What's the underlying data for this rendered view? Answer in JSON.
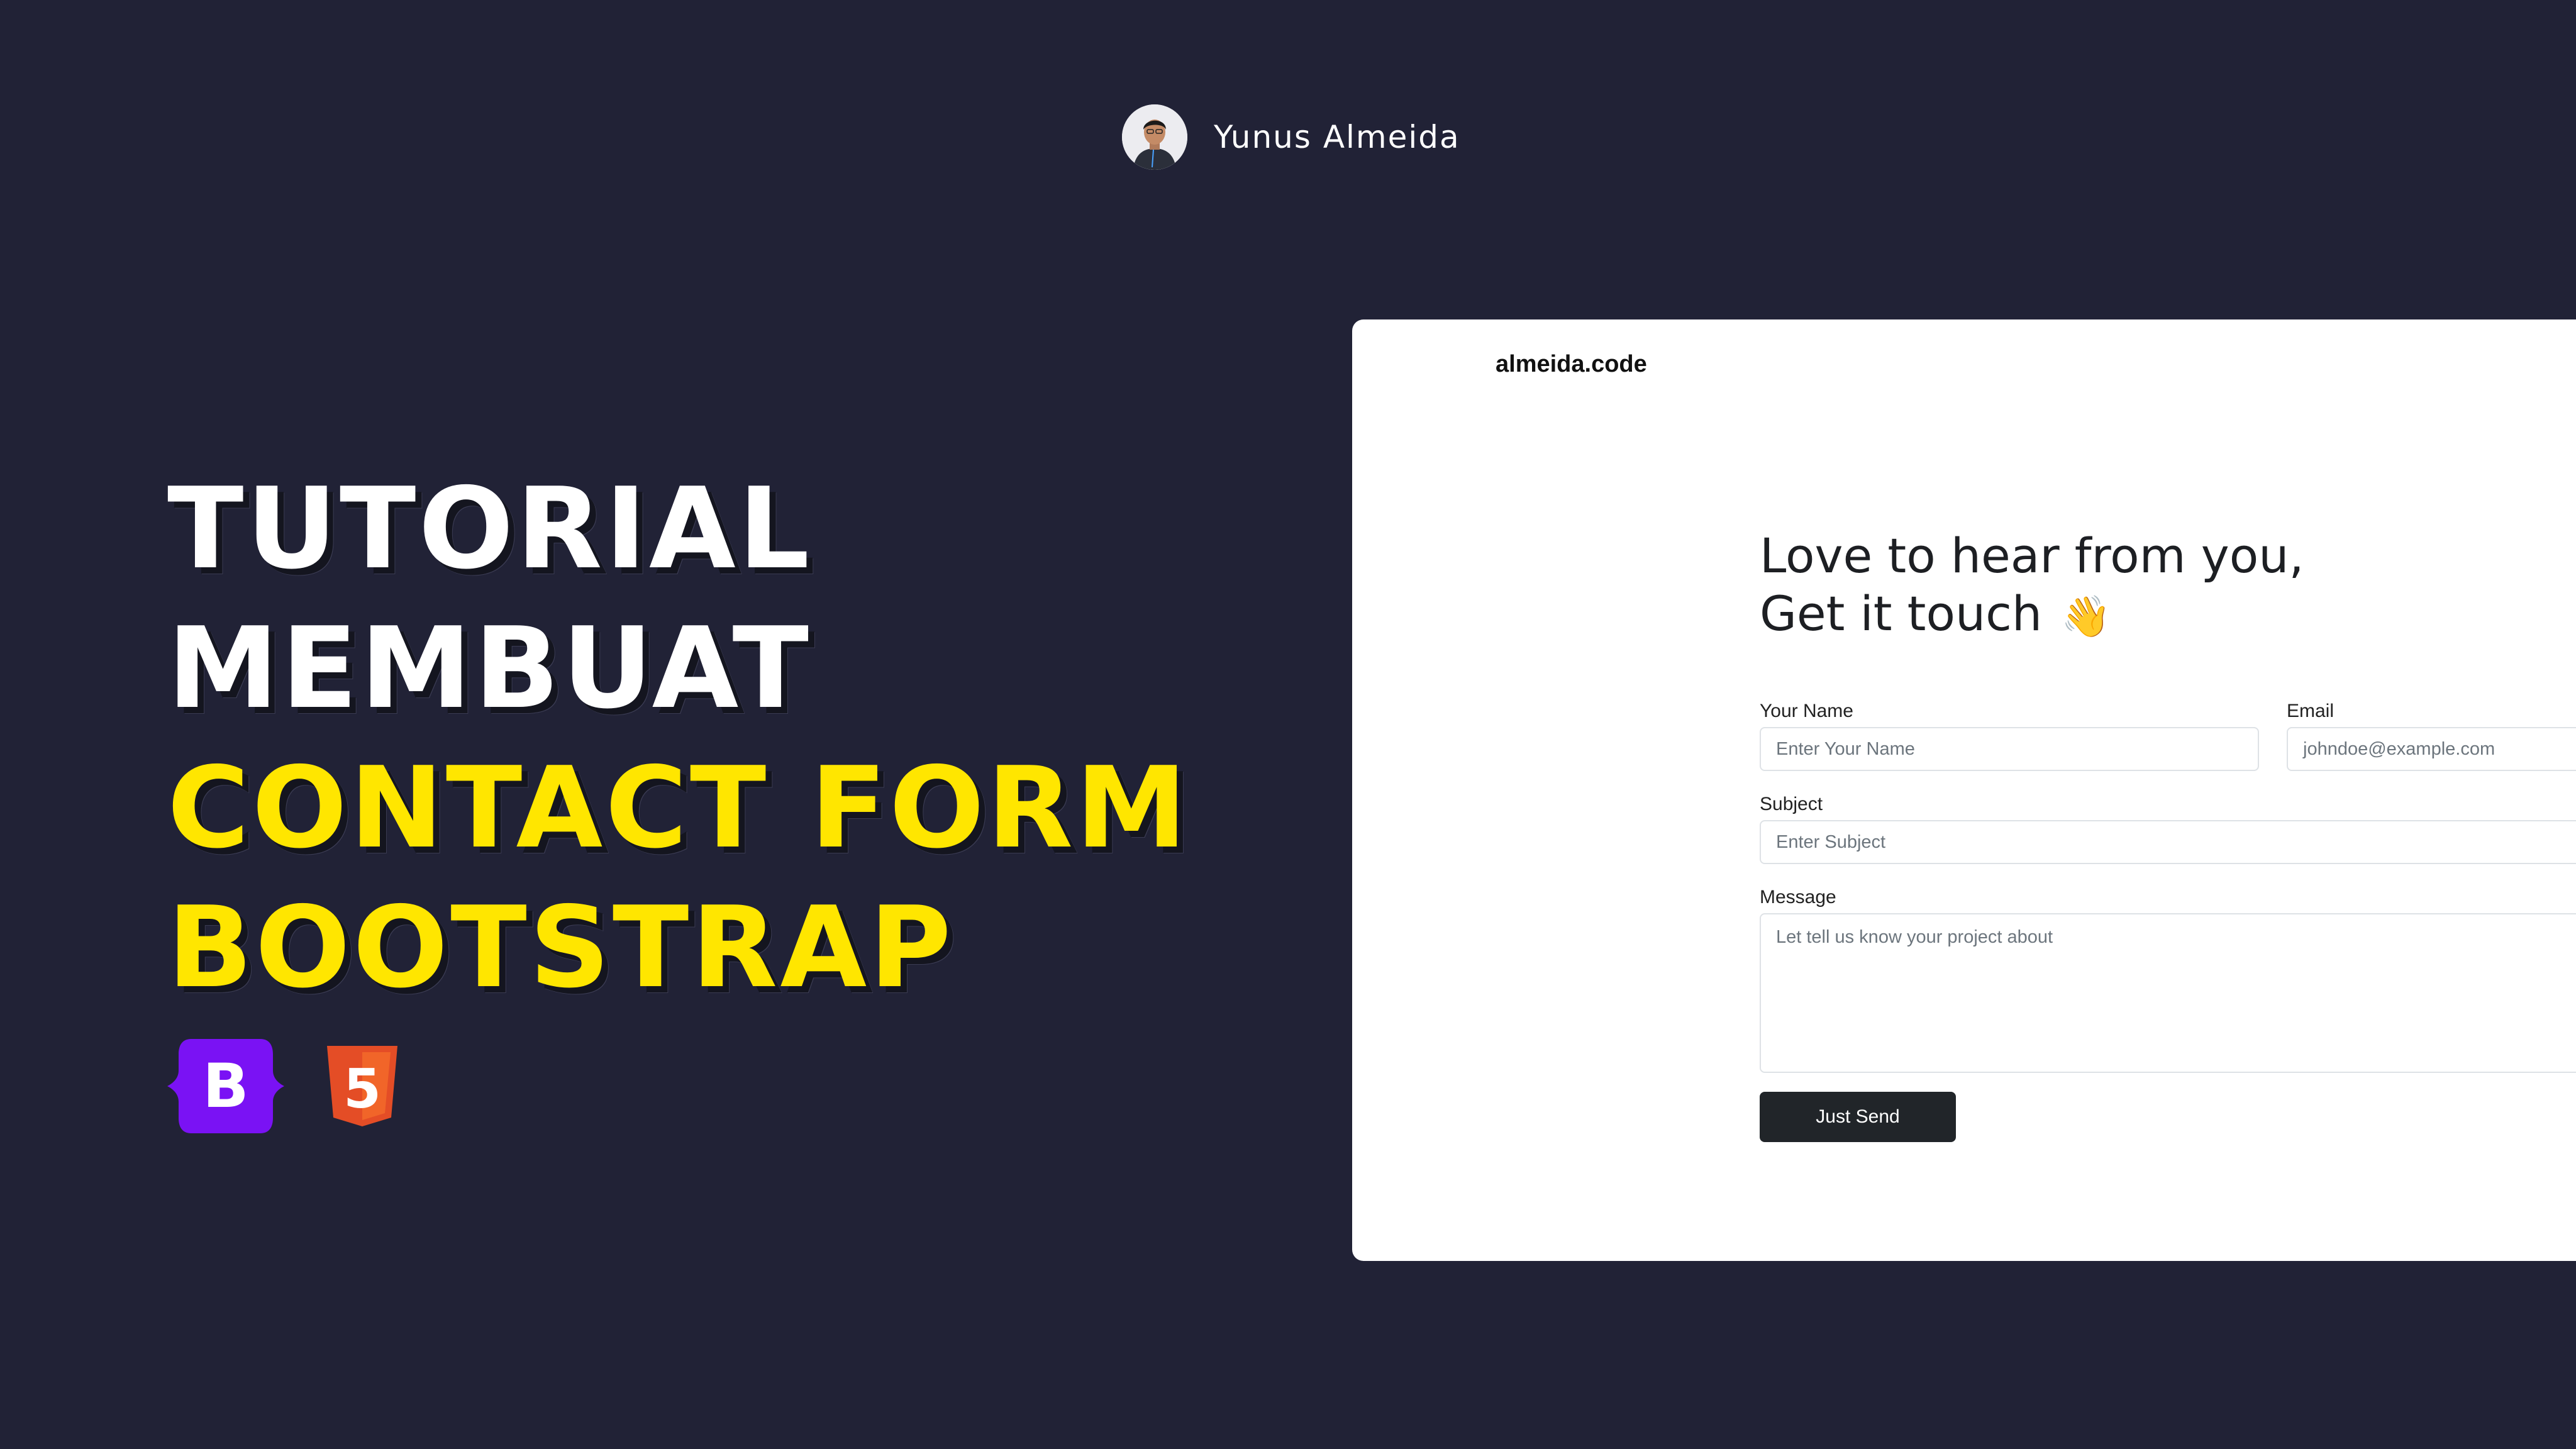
{
  "author": {
    "name": "Yunus Almeida",
    "avatar_icon": "person-avatar-icon"
  },
  "title": {
    "line1": "TUTORIAL",
    "line2": "MEMBUAT",
    "line3": "CONTACT FORM",
    "line4": "BOOTSTRAP",
    "white_color": "#ffffff",
    "accent_color": "#ffe600"
  },
  "logos": [
    {
      "icon": "bootstrap-logo-icon",
      "glyph": "B",
      "color": "#7a12f4"
    },
    {
      "icon": "html5-logo-icon",
      "glyph": "5",
      "color": "#e44d26"
    }
  ],
  "preview": {
    "brand": "almeida.code",
    "heading_line1": "Love to hear from you,",
    "heading_line2": "Get it touch",
    "heading_emoji": "👋",
    "form": {
      "name_label": "Your Name",
      "name_placeholder": "Enter Your Name",
      "email_label": "Email",
      "email_placeholder": "johndoe@example.com",
      "subject_label": "Subject",
      "subject_placeholder": "Enter Subject",
      "message_label": "Message",
      "message_placeholder": "Let tell us know your project about",
      "submit_label": "Just Send"
    }
  },
  "colors": {
    "background": "#212236",
    "button": "#212529"
  }
}
